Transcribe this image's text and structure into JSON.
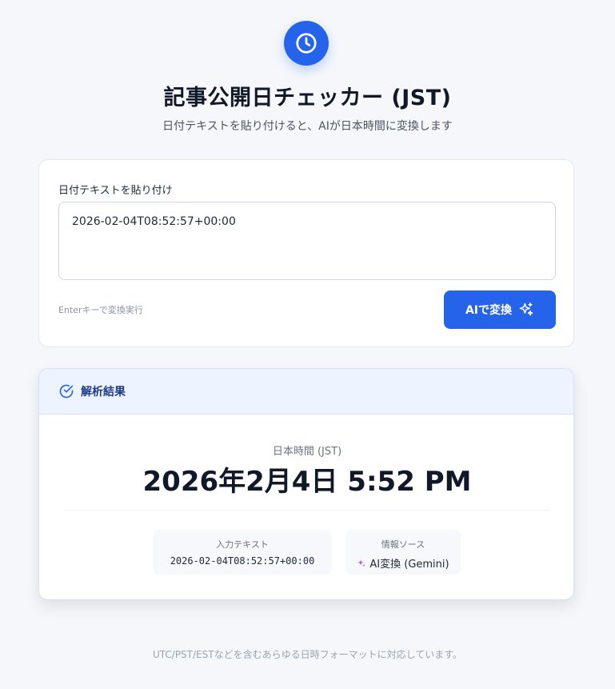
{
  "header": {
    "logo_icon": "clock-icon",
    "title": "記事公開日チェッカー (JST)",
    "subtitle": "日付テキストを貼り付けると、AIが日本時間に変換します"
  },
  "input_card": {
    "label": "日付テキストを貼り付け",
    "textarea_value": "2026-02-04T08:52:57+00:00",
    "hint": "Enterキーで変換実行",
    "convert_button_label": "AIで変換",
    "convert_button_icon": "sparkles-icon"
  },
  "result_card": {
    "header_icon": "check-circle-icon",
    "header_label": "解析結果",
    "jst_label": "日本時間 (JST)",
    "jst_value": "2026年2月4日 5:52 PM",
    "input_text_label": "入力テキスト",
    "input_text_value": "2026-02-04T08:52:57+00:00",
    "source_label": "情報ソース",
    "source_icon": "sparkles-icon",
    "source_value": "AI変換 (Gemini)"
  },
  "footer": {
    "text": "UTC/PST/ESTなどを含むあらゆる日時フォーマットに対応しています。"
  },
  "colors": {
    "accent": "#2563eb",
    "result_header_bg": "#eef4ff",
    "result_header_text": "#1e3a8a"
  }
}
